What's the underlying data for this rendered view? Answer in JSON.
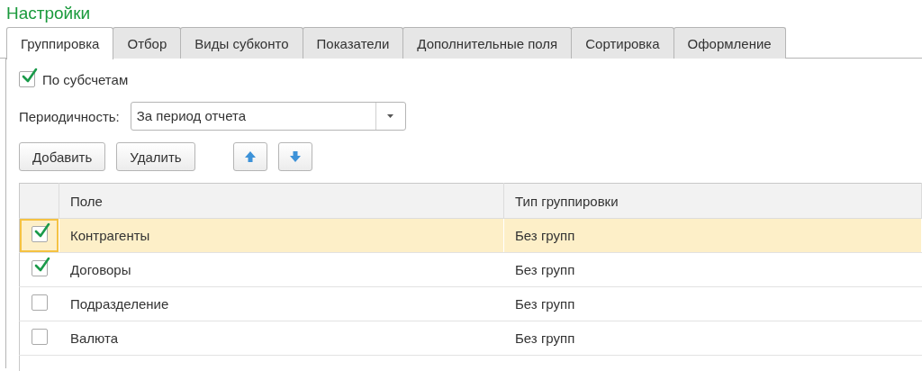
{
  "title": "Настройки",
  "tabs": [
    {
      "label": "Группировка",
      "selected": true
    },
    {
      "label": "Отбор",
      "selected": false
    },
    {
      "label": "Виды субконто",
      "selected": false
    },
    {
      "label": "Показатели",
      "selected": false
    },
    {
      "label": "Дополнительные поля",
      "selected": false
    },
    {
      "label": "Сортировка",
      "selected": false
    },
    {
      "label": "Оформление",
      "selected": false
    }
  ],
  "by_subaccounts": {
    "label": "По субсчетам",
    "checked": true
  },
  "periodicity": {
    "label": "Периодичность:",
    "value": "За период отчета"
  },
  "buttons": [
    {
      "kind": "text",
      "label": "Добавить"
    },
    {
      "kind": "text",
      "label": "Удалить"
    },
    {
      "kind": "up"
    },
    {
      "kind": "down"
    }
  ],
  "table": {
    "columns": [
      "Поле",
      "Тип группировки"
    ],
    "rows": [
      {
        "checked": true,
        "field": "Контрагенты",
        "grouping": "Без групп",
        "selected": true
      },
      {
        "checked": true,
        "field": "Договоры",
        "grouping": "Без групп",
        "selected": false
      },
      {
        "checked": false,
        "field": "Подразделение",
        "grouping": "Без групп",
        "selected": false
      },
      {
        "checked": false,
        "field": "Валюта",
        "grouping": "Без групп",
        "selected": false
      }
    ]
  }
}
